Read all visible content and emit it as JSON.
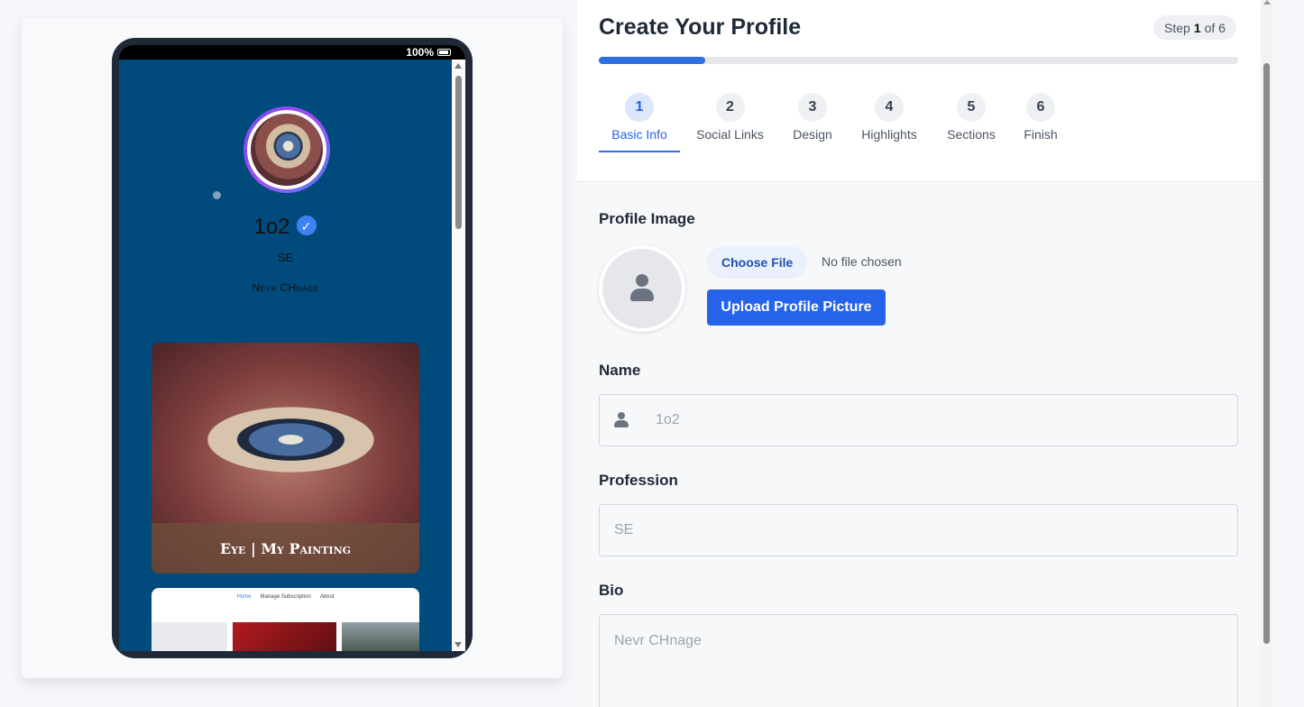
{
  "preview": {
    "status_battery": "100%",
    "name": "1o2",
    "profession": "SE",
    "bio": "Nevr CHnage",
    "painting_caption": "Eye | My Painting",
    "mini_nav": [
      "Home",
      "Manage Subscription",
      "About"
    ]
  },
  "form": {
    "title": "Create Your Profile",
    "step_prefix": "Step",
    "step_current": "1",
    "step_suffix": "of 6",
    "progress_fraction": 0.1667,
    "steps": [
      {
        "num": "1",
        "label": "Basic Info"
      },
      {
        "num": "2",
        "label": "Social Links"
      },
      {
        "num": "3",
        "label": "Design"
      },
      {
        "num": "4",
        "label": "Highlights"
      },
      {
        "num": "5",
        "label": "Sections"
      },
      {
        "num": "6",
        "label": "Finish"
      }
    ],
    "profile_image_label": "Profile Image",
    "choose_file_label": "Choose File",
    "no_file_text": "No file chosen",
    "upload_button": "Upload Profile Picture",
    "name_label": "Name",
    "name_placeholder": "1o2",
    "profession_label": "Profession",
    "profession_placeholder": "SE",
    "bio_label": "Bio",
    "bio_placeholder": "Nevr CHnage"
  },
  "colors": {
    "accent": "#2563eb",
    "preview_bg": "#004a7c"
  }
}
